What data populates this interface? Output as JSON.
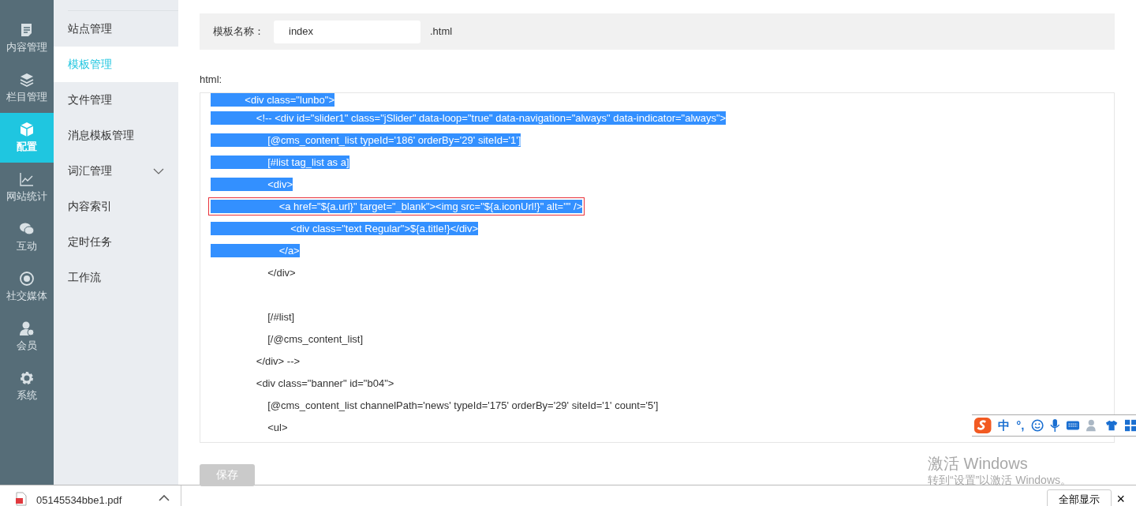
{
  "nav": [
    {
      "label": "内容管理",
      "selected": false
    },
    {
      "label": "栏目管理",
      "selected": false
    },
    {
      "label": "配置",
      "selected": true
    },
    {
      "label": "网站统计",
      "selected": false
    },
    {
      "label": "互动",
      "selected": false
    },
    {
      "label": "社交媒体",
      "selected": false
    },
    {
      "label": "会员",
      "selected": false
    },
    {
      "label": "系统",
      "selected": false
    }
  ],
  "submenu": [
    {
      "label": "站点管理",
      "selected": false
    },
    {
      "label": "模板管理",
      "selected": true
    },
    {
      "label": "文件管理",
      "selected": false
    },
    {
      "label": "消息模板管理",
      "selected": false
    },
    {
      "label": "词汇管理",
      "selected": false,
      "expanded": false
    },
    {
      "label": "内容索引",
      "selected": false
    },
    {
      "label": "定时任务",
      "selected": false
    },
    {
      "label": "工作流",
      "selected": false
    }
  ],
  "form": {
    "label": "模板名称：",
    "value": "index",
    "suffix": ".html"
  },
  "editor": {
    "label": "html:",
    "lines": [
      {
        "text": "            <div class=\"lunbo\">",
        "selected": true
      },
      {
        "text": "                <!-- <div id=\"slider1\" class=\"jSlider\" data-loop=\"true\" data-navigation=\"always\" data-indicator=\"always\">",
        "selected": true
      },
      {
        "text": "                    [@cms_content_list typeId='186' orderBy='29' siteId='1']",
        "selected": true
      },
      {
        "text": "                    [#list tag_list as a]",
        "selected": true
      },
      {
        "text": "                    <div>",
        "selected": true
      },
      {
        "text": "                        <a href=\"${a.url}\" target=\"_blank\"><img src=\"${a.iconUrl!}\" alt=\"\" />",
        "selected": true,
        "boxed": true
      },
      {
        "text": "                            <div class=\"text Regular\">${a.title!}</div>",
        "selected": true
      },
      {
        "text": "                        </a>",
        "selected": true
      },
      {
        "text": "                    </div>",
        "selected": false,
        "gap_after": true
      },
      {
        "text": "                    [/#list]",
        "selected": false
      },
      {
        "text": "                    [/@cms_content_list]",
        "selected": false
      },
      {
        "text": "                </div> -->",
        "selected": false
      },
      {
        "text": "                <div class=\"banner\" id=\"b04\">",
        "selected": false
      },
      {
        "text": "                    [@cms_content_list channelPath='news' typeId='175' orderBy='29' siteId='1' count='5']",
        "selected": false
      },
      {
        "text": "                    <ul>",
        "selected": false
      }
    ]
  },
  "save_button": {
    "label": "保存",
    "disabled": true
  },
  "ime_toolbar": {
    "items": [
      "中",
      "°,"
    ]
  },
  "activation_notice": {
    "title": "激活 Windows",
    "subtitle": "转到“设置”以激活 Windows。"
  },
  "download_bar": {
    "file": "05145534bbe1.pdf",
    "show_all": "全部显示",
    "close": "×"
  }
}
